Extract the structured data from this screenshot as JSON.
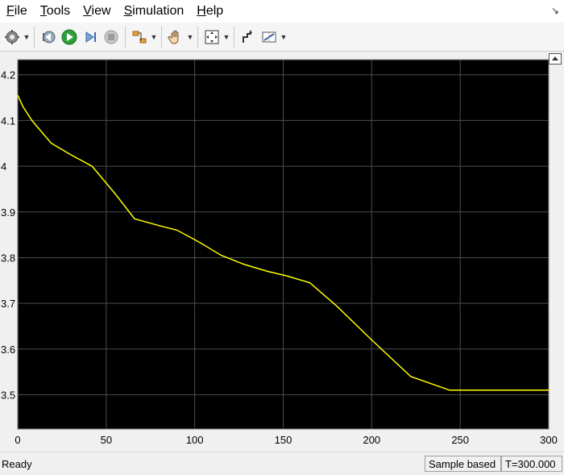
{
  "menu": {
    "items": [
      {
        "label": "File",
        "u": "F",
        "rest": "ile"
      },
      {
        "label": "Tools",
        "u": "T",
        "rest": "ools"
      },
      {
        "label": "View",
        "u": "V",
        "rest": "iew"
      },
      {
        "label": "Simulation",
        "u": "S",
        "rest": "imulation"
      },
      {
        "label": "Help",
        "u": "H",
        "rest": "elp"
      }
    ]
  },
  "toolbar": {
    "icons": [
      "gear-icon",
      "step-back-icon",
      "run-icon",
      "step-forward-icon",
      "stop-icon",
      "signal-select-icon",
      "pan-icon",
      "zoom-fit-icon",
      "cursor-measure-icon",
      "data-cursor-icon"
    ]
  },
  "status": {
    "text": "Ready",
    "mode": "Sample based",
    "time": "T=300.000"
  },
  "colors": {
    "plot_bg": "#000000",
    "grid": "#4d4d4d",
    "trace": "#ffff00",
    "tick_text": "#000000"
  },
  "chart_data": {
    "type": "line",
    "title": "",
    "xlabel": "",
    "ylabel": "",
    "xlim": [
      0,
      300
    ],
    "ylim": [
      3.425,
      4.233
    ],
    "xticks": [
      0,
      50,
      100,
      150,
      200,
      250,
      300
    ],
    "yticks": [
      3.5,
      3.6,
      3.7,
      3.8,
      3.9,
      4,
      4.1,
      4.2
    ],
    "ytick_labels": [
      "3.5",
      "3.6",
      "3.7",
      "3.8",
      "3.9",
      "4",
      "4.1",
      "4.2"
    ],
    "grid": true,
    "series": [
      {
        "x": [
          0,
          3,
          8,
          19,
          30,
          42,
          55,
          66,
          80,
          90,
          102,
          115,
          128,
          141,
          152,
          165,
          180,
          200,
          222,
          244,
          270,
          300
        ],
        "y": [
          4.155,
          4.13,
          4.1,
          4.05,
          4.025,
          4.0,
          3.94,
          3.885,
          3.87,
          3.86,
          3.835,
          3.805,
          3.785,
          3.77,
          3.76,
          3.745,
          3.695,
          3.62,
          3.54,
          3.51,
          3.51,
          3.51
        ]
      }
    ]
  }
}
